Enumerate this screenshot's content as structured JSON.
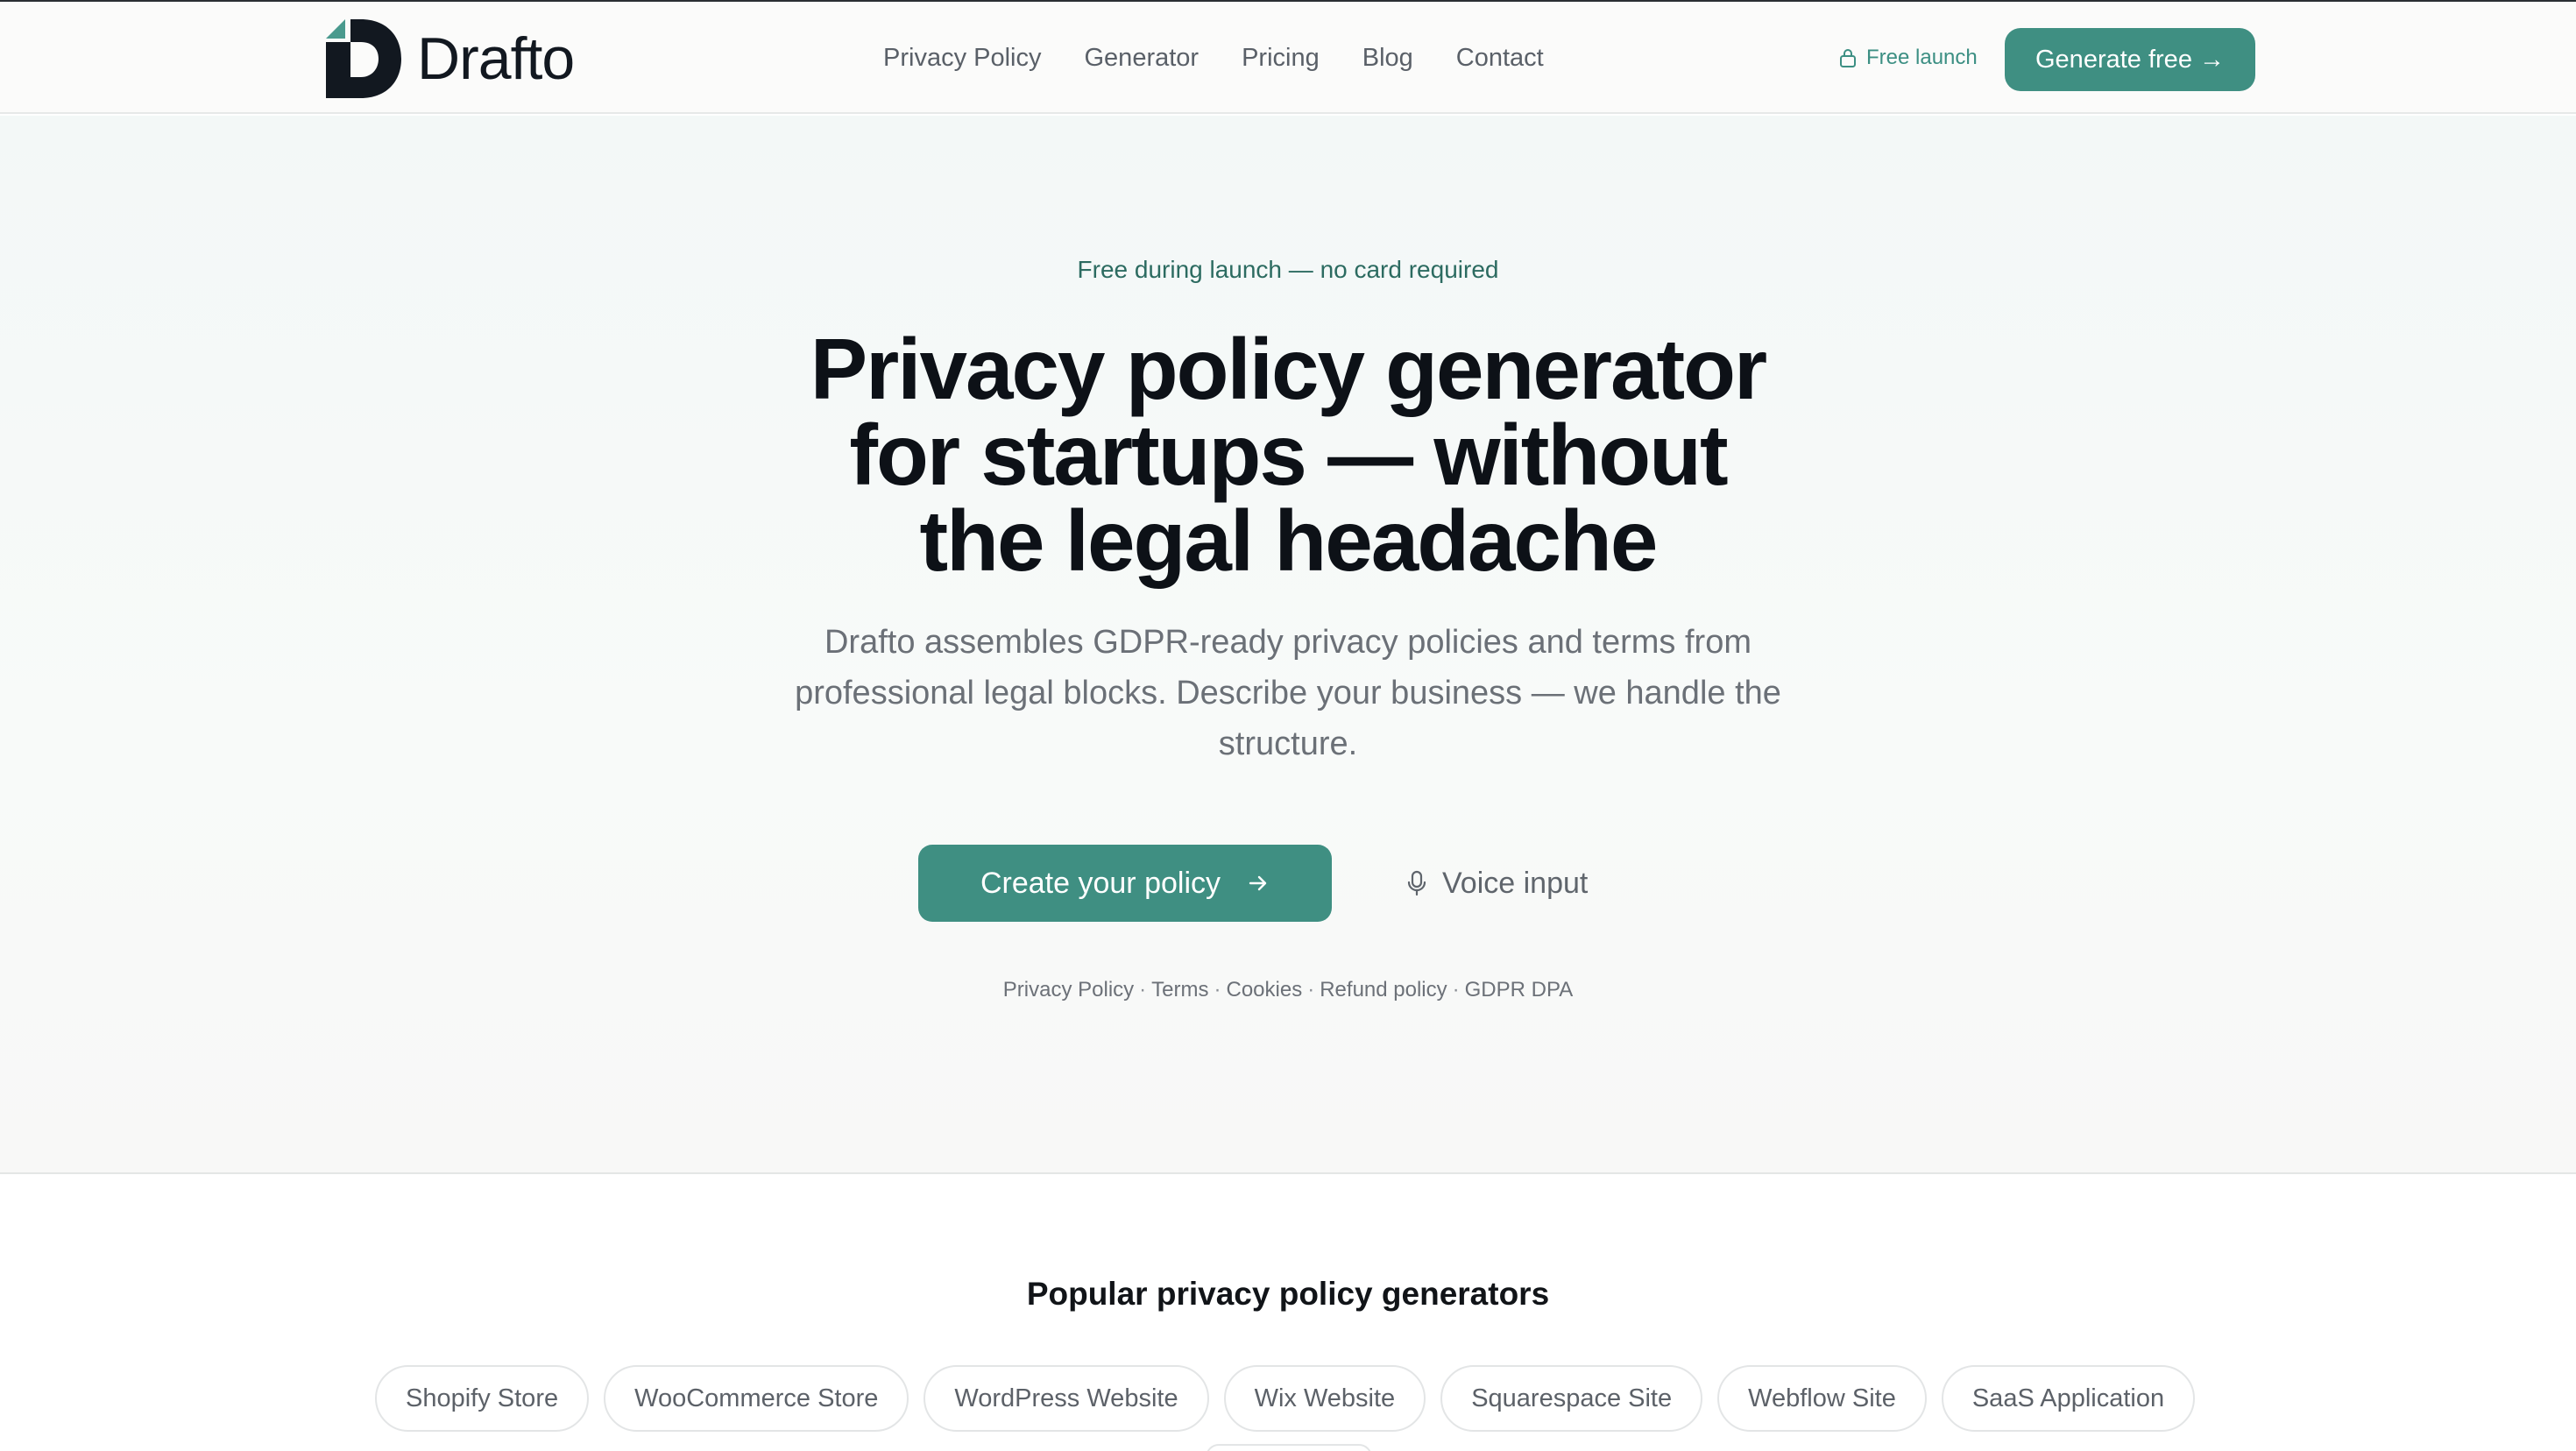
{
  "brand": {
    "name": "Drafto",
    "colors": {
      "accent": "#3f8f82",
      "logo_dark": "#121820",
      "logo_accent": "#4a9a8e"
    }
  },
  "nav": {
    "items": [
      {
        "label": "Privacy Policy"
      },
      {
        "label": "Generator"
      },
      {
        "label": "Pricing"
      },
      {
        "label": "Blog"
      },
      {
        "label": "Contact"
      }
    ],
    "free_badge": {
      "label": "Free launch",
      "icon": "lock-icon"
    },
    "cta": {
      "label": "Generate free →"
    }
  },
  "hero": {
    "eyebrow": "Free during launch — no card required",
    "title_lines": [
      "Privacy policy generator",
      "for startups — without",
      "the legal headache"
    ],
    "subtitle": "Drafto assembles GDPR-ready privacy policies and terms from professional legal blocks. Describe your business — we handle the structure.",
    "primary_cta": {
      "label": "Create your policy",
      "icon": "arrow-right-icon"
    },
    "secondary_cta": {
      "label": "Voice input",
      "icon": "microphone-icon"
    },
    "doc_links": [
      "Privacy Policy",
      "Terms",
      "Cookies",
      "Refund policy",
      "GDPR DPA"
    ],
    "doc_separator": "·"
  },
  "popular": {
    "title": "Popular privacy policy generators",
    "chips": [
      "Shopify Store",
      "WooCommerce Store",
      "WordPress Website",
      "Wix Website",
      "Squarespace Site",
      "Webflow Site",
      "SaaS Application"
    ]
  }
}
